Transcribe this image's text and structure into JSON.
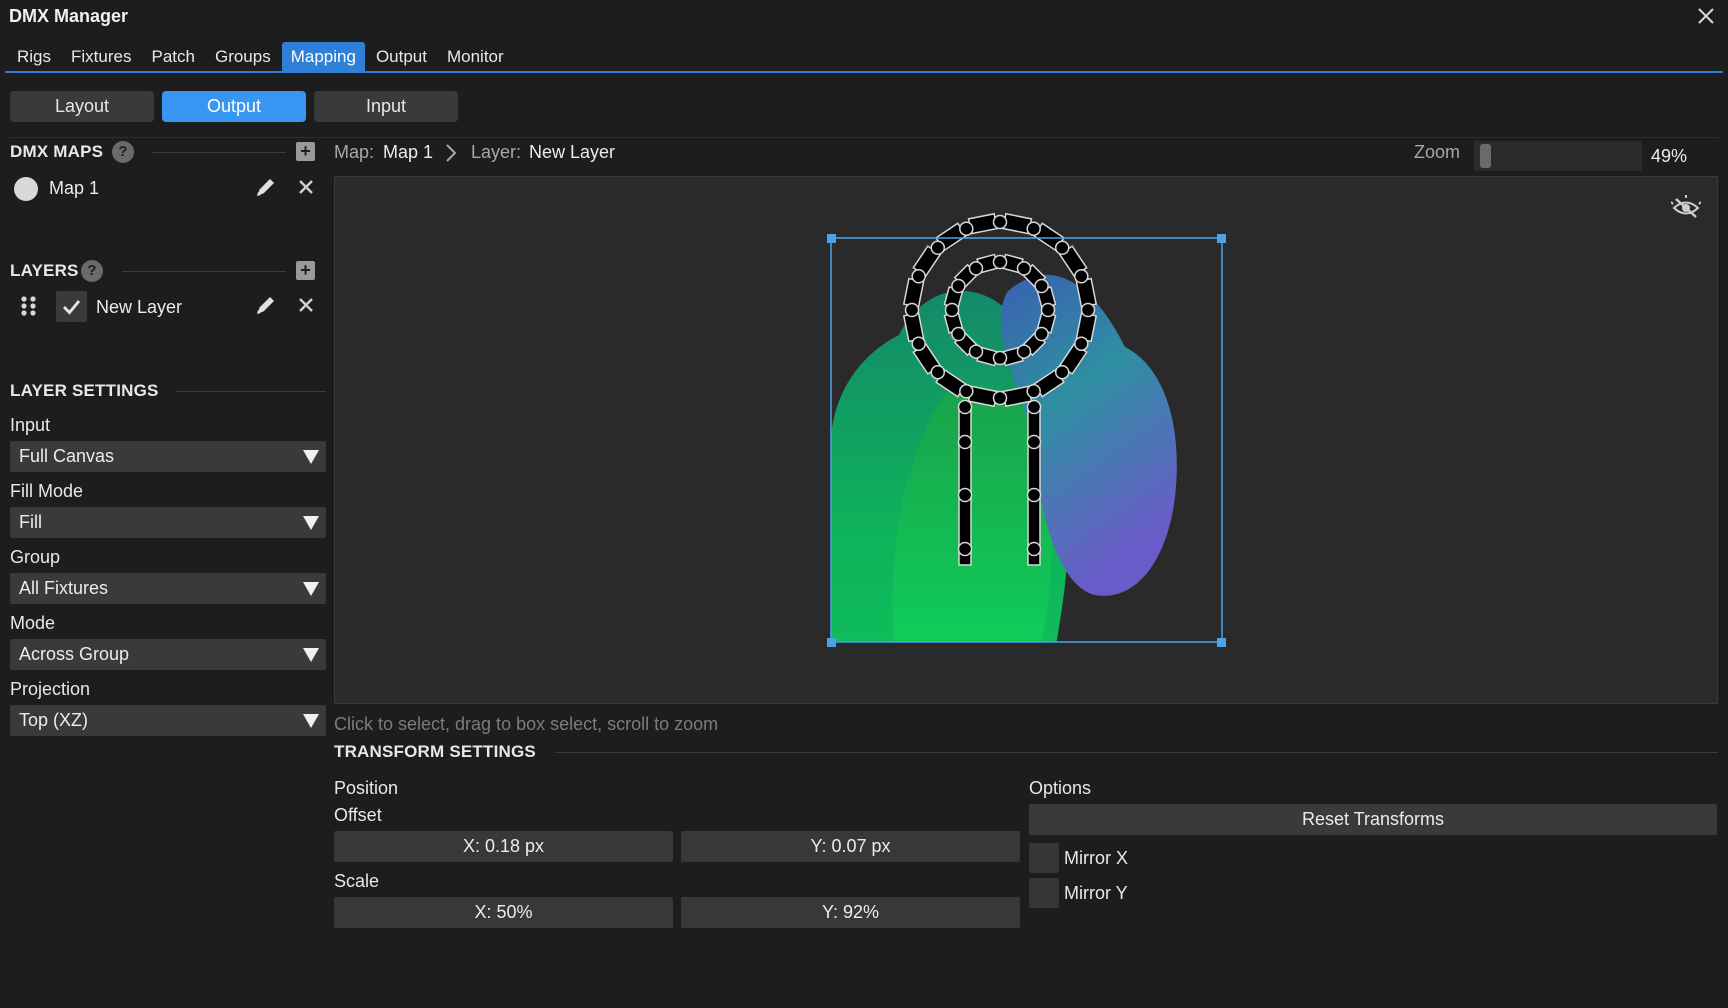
{
  "app": {
    "title": "DMX Manager"
  },
  "main_tabs": [
    {
      "label": "Rigs",
      "active": false
    },
    {
      "label": "Fixtures",
      "active": false
    },
    {
      "label": "Patch",
      "active": false
    },
    {
      "label": "Groups",
      "active": false
    },
    {
      "label": "Mapping",
      "active": true
    },
    {
      "label": "Output",
      "active": false
    },
    {
      "label": "Monitor",
      "active": false
    }
  ],
  "sub_tabs": [
    {
      "label": "Layout",
      "active": false
    },
    {
      "label": "Output",
      "active": true
    },
    {
      "label": "Input",
      "active": false
    }
  ],
  "sidebar": {
    "dmx_maps": {
      "title": "DMX MAPS",
      "help": "?",
      "add": "+",
      "items": [
        {
          "label": "Map 1"
        }
      ]
    },
    "layers": {
      "title": "LAYERS",
      "help": "?",
      "add": "+",
      "items": [
        {
          "label": "New Layer",
          "checked": true
        }
      ]
    },
    "layer_settings": {
      "title": "LAYER SETTINGS",
      "fields": [
        {
          "label": "Input",
          "value": "Full Canvas"
        },
        {
          "label": "Fill Mode",
          "value": "Fill"
        },
        {
          "label": "Group",
          "value": "All Fixtures"
        },
        {
          "label": "Mode",
          "value": "Across Group"
        },
        {
          "label": "Projection",
          "value": "Top (XZ)"
        }
      ]
    }
  },
  "breadcrumb": {
    "map_key": "Map:",
    "map_value": "Map 1",
    "layer_key": "Layer:",
    "layer_value": "New Layer"
  },
  "zoom": {
    "label": "Zoom",
    "value": "49%",
    "fraction": 0.02
  },
  "canvas": {
    "hint": "Click to select, drag to box select, scroll to zoom"
  },
  "transform": {
    "title": "TRANSFORM SETTINGS",
    "position_label": "Position",
    "offset_label": "Offset",
    "offset_x": "X: 0.18 px",
    "offset_y": "Y: 0.07 px",
    "scale_label": "Scale",
    "scale_x": "X: 50%",
    "scale_y": "Y: 92%",
    "options_label": "Options",
    "reset_label": "Reset Transforms",
    "mirror_x": "Mirror X",
    "mirror_y": "Mirror Y"
  },
  "colors": {
    "accent": "#3796f2",
    "tab_active": "#2e7fd6",
    "selection": "#4aa3e8"
  },
  "icons": {
    "close": "close-icon",
    "help": "help-icon",
    "add": "add-icon",
    "edit": "pencil-icon",
    "delete": "x-icon",
    "drag": "drag-handle-icon",
    "check": "check-icon",
    "dropdown": "triangle-down-icon",
    "breadcrumb_sep": "chevron-right-icon",
    "visibility": "eye-off-icon"
  }
}
